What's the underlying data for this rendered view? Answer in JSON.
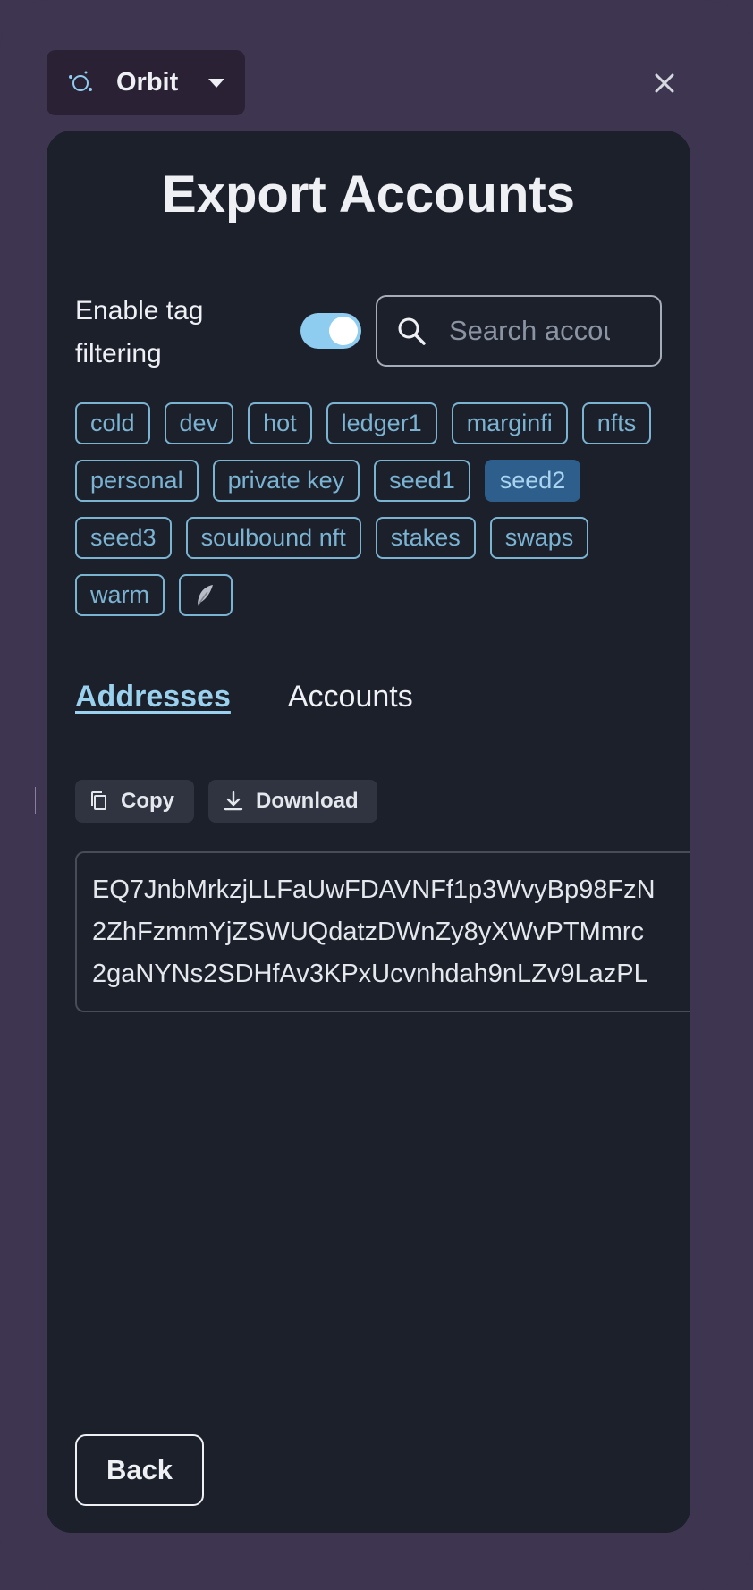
{
  "header": {
    "wallet_name": "Orbit",
    "wallet_icon": "orbit-icon",
    "dropdown_icon": "caret-down-icon",
    "close_icon": "close-icon"
  },
  "panel": {
    "title": "Export Accounts",
    "filter_label": "Enable tag filtering",
    "filter_enabled": true,
    "search_placeholder": "Search accounts"
  },
  "tags": [
    {
      "label": "cold",
      "active": false
    },
    {
      "label": "dev",
      "active": false
    },
    {
      "label": "hot",
      "active": false
    },
    {
      "label": "ledger1",
      "active": false
    },
    {
      "label": "marginfi",
      "active": false
    },
    {
      "label": "nfts",
      "active": false
    },
    {
      "label": "personal",
      "active": false
    },
    {
      "label": "private key",
      "active": false
    },
    {
      "label": "seed1",
      "active": false
    },
    {
      "label": "seed2",
      "active": true
    },
    {
      "label": "seed3",
      "active": false
    },
    {
      "label": "soulbound nft",
      "active": false
    },
    {
      "label": "stakes",
      "active": false
    },
    {
      "label": "swaps",
      "active": false
    },
    {
      "label": "warm",
      "active": false
    },
    {
      "label": "",
      "icon": "feather-icon",
      "active": false
    }
  ],
  "tabs": {
    "addresses": "Addresses",
    "accounts": "Accounts",
    "active": "addresses"
  },
  "actions": {
    "copy": "Copy",
    "download": "Download"
  },
  "addresses": [
    "EQ7JnbMrkzjLLFaUwFDAVNFf1p3WvyBp98FzN",
    "2ZhFzmmYjZSWUQdatzDWnZy8yXWvPTMmrc",
    "2gaNYNs2SDHfAv3KPxUcvnhdah9nLZv9LazPL"
  ],
  "footer": {
    "back": "Back"
  },
  "colors": {
    "background": "#3e3550",
    "panel": "#1c202b",
    "accent": "#8ecdf0",
    "tag": "#7bb3d3",
    "tag_active": "#2d5e8c"
  }
}
